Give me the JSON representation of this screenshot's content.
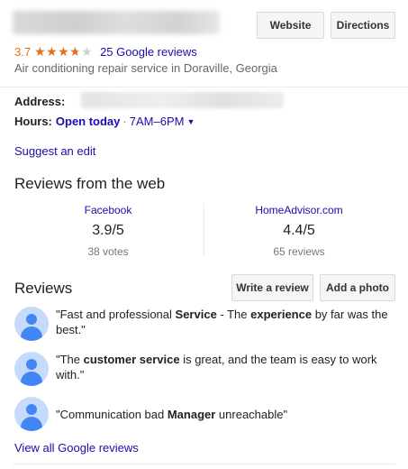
{
  "header": {
    "website_label": "Website",
    "directions_label": "Directions"
  },
  "rating": {
    "value": "3.7",
    "stars": 3.7,
    "max_stars": 5,
    "reviews_count_label": "25 Google reviews"
  },
  "category": "Air conditioning repair service in Doraville, Georgia",
  "address": {
    "label": "Address:"
  },
  "hours": {
    "label": "Hours:",
    "status": "Open today",
    "separator": "·",
    "range": "7AM–6PM"
  },
  "suggest_edit": "Suggest an edit",
  "web_reviews": {
    "title": "Reviews from the web",
    "sources": [
      {
        "name": "Facebook",
        "score": "3.9/5",
        "count": "38 votes"
      },
      {
        "name": "HomeAdvisor.com",
        "score": "4.4/5",
        "count": "65 reviews"
      }
    ]
  },
  "reviews": {
    "title": "Reviews",
    "write_review_label": "Write a review",
    "add_photo_label": "Add a photo",
    "items": [
      {
        "segments": [
          {
            "text": "\"Fast and professional ",
            "bold": false
          },
          {
            "text": "Service",
            "bold": true
          },
          {
            "text": " - The ",
            "bold": false
          },
          {
            "text": "experience",
            "bold": true
          },
          {
            "text": " by far was the best.\"",
            "bold": false
          }
        ]
      },
      {
        "segments": [
          {
            "text": "\"The ",
            "bold": false
          },
          {
            "text": "customer service",
            "bold": true
          },
          {
            "text": " is great, and the team is easy to work with.\"",
            "bold": false
          }
        ]
      },
      {
        "segments": [
          {
            "text": "\"Communication bad ",
            "bold": false
          },
          {
            "text": "Manager",
            "bold": true
          },
          {
            "text": " unreachable\"",
            "bold": false
          }
        ]
      }
    ],
    "view_all_label": "View all Google reviews"
  },
  "colors": {
    "link": "#1a0dab",
    "star": "#e7711b",
    "avatar_bg": "#c6dafc",
    "avatar_fg": "#4285f4"
  }
}
